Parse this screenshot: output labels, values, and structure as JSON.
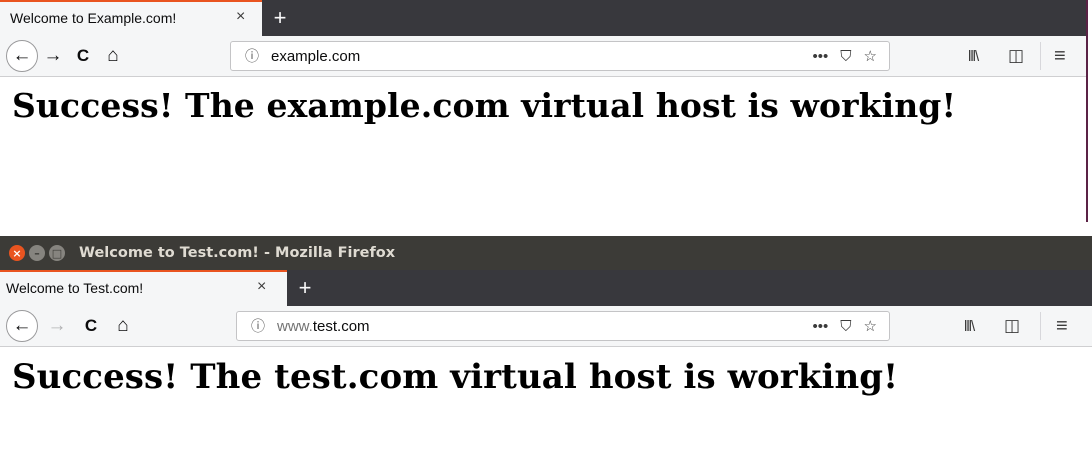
{
  "windows": [
    {
      "tab": {
        "title": "Welcome to Example.com!",
        "close": "×"
      },
      "new_tab": "+",
      "nav": {
        "back": "←",
        "forward": "→",
        "reload": "C",
        "home": "⌂"
      },
      "url": {
        "info": "ⓘ",
        "prefix": "",
        "host": "example.com"
      },
      "url_actions": {
        "more": "•••",
        "pocket": "⛉",
        "bookmark": "☆"
      },
      "toolbar": {
        "library": "lll\\",
        "sidebar": "◫",
        "menu": "≡"
      },
      "heading": "Success! The example.com virtual host is working!"
    },
    {
      "titlebar": {
        "close": "×",
        "minimize": "–",
        "maximize": "□",
        "title": "Welcome to Test.com! - Mozilla Firefox"
      },
      "tab": {
        "title": "Welcome to Test.com!",
        "close": "×"
      },
      "new_tab": "+",
      "nav": {
        "back": "←",
        "forward": "→",
        "reload": "C",
        "home": "⌂"
      },
      "url": {
        "info": "ⓘ",
        "prefix": "www.",
        "host": "test.com"
      },
      "url_actions": {
        "more": "•••",
        "pocket": "⛉",
        "bookmark": "☆"
      },
      "toolbar": {
        "library": "lll\\",
        "sidebar": "◫",
        "menu": "≡"
      },
      "heading": "Success! The test.com virtual host is working!"
    }
  ],
  "colors": {
    "accent": "#e95420",
    "titlebar": "#3c3b37",
    "tabbar": "#38383d",
    "toolbar": "#f5f6f7"
  }
}
